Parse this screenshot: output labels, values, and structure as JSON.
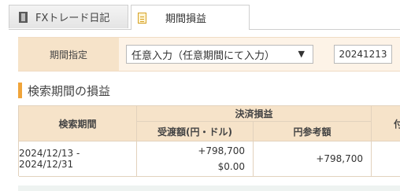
{
  "tabs": [
    {
      "label": "FXトレード日記",
      "icon": "book-icon",
      "active": false
    },
    {
      "label": "期間損益",
      "icon": "document-icon",
      "active": true
    }
  ],
  "period_filter": {
    "label": "期間指定",
    "selected_option": "任意入力（任意期間にて入力）",
    "date_value": "20241213"
  },
  "section": {
    "title": "検索期間の損益",
    "accent_color": "#f0a43a"
  },
  "results_table": {
    "header_period": "検索期間",
    "header_settlement": "決済損益",
    "header_delivery": "受渡額(円・ドル)",
    "header_yen_reference": "円参考額",
    "header_extra_partial": "付",
    "rows": [
      {
        "period": "2024/12/13 - 2024/12/31",
        "delivery_yen": "+798,700",
        "delivery_usd": "$0.00",
        "yen_reference": "+798,700"
      }
    ]
  },
  "colors": {
    "header_bg": "#f6e3c9",
    "filter_bg": "#fdf3e7"
  }
}
